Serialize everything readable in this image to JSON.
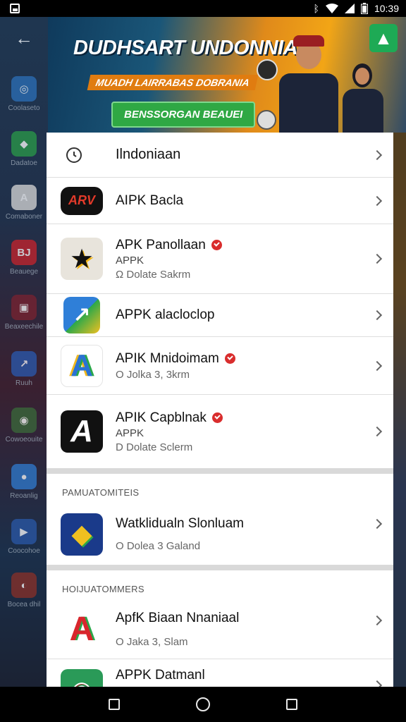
{
  "status": {
    "time": "10:39"
  },
  "side_apps": [
    {
      "label": "Coolaseto",
      "color": "#2c6fb8",
      "glyph": "◎"
    },
    {
      "label": "Dadatoe",
      "color": "#2a9a48",
      "glyph": "◆"
    },
    {
      "label": "Comaboner",
      "color": "#d8d8d8",
      "glyph": "A"
    },
    {
      "label": "Beauege",
      "color": "#c8232c",
      "glyph": "BJ"
    },
    {
      "label": "Beaxeechile",
      "color": "#7a2230",
      "glyph": "▣"
    },
    {
      "label": "Ruuh",
      "color": "#2a5ab0",
      "glyph": "↗"
    },
    {
      "label": "Cowoeouite",
      "color": "#3a6a3a",
      "glyph": "◉"
    },
    {
      "label": "Reoanlig",
      "color": "#2f7bd0",
      "glyph": "●"
    },
    {
      "label": "Coocohoe",
      "color": "#2a58a8",
      "glyph": "▶"
    },
    {
      "label": "Bocea dhil",
      "color": "#8a3028",
      "glyph": "◐"
    }
  ],
  "banner": {
    "title": "DUDHSART UNDONNIAN",
    "subtitle": "MUADH LAIRRABAS DOBRANIA",
    "cta": "BENSSORGAN BEAUEI"
  },
  "list": {
    "header_item": {
      "label": "Ilndoniaan"
    },
    "items": [
      {
        "title": "AIPK Bacla",
        "icon_text": "ARV",
        "verified": false,
        "sub": "",
        "meta": ""
      },
      {
        "title": "APK Panollaan",
        "icon_text": "★",
        "verified": true,
        "sub": "APPK",
        "meta": "Ω Dolate Sakrm"
      },
      {
        "title": "APPK alacloclop",
        "icon_text": "↗",
        "verified": false,
        "sub": "",
        "meta": ""
      },
      {
        "title": "APIK Mnidoimam",
        "icon_text": "A",
        "verified": true,
        "sub": "",
        "meta": "O Jolka 3, 3krm"
      },
      {
        "title": "APIK Capblnak",
        "icon_text": "A",
        "verified": true,
        "sub": "APPK",
        "meta": "D Dolate Sclerm"
      }
    ],
    "section1": {
      "heading": "PAMUATOMITEIS",
      "items": [
        {
          "title": "Watklidualn Slonluam",
          "icon_text": "◆",
          "meta": "O Dolea 3 Galand"
        }
      ]
    },
    "section2": {
      "heading": "HOIJUATOMMERS",
      "items": [
        {
          "title": "ApfK Biaan Nnaniaal",
          "icon_text": "A",
          "meta": "O Jaka 3, Slam"
        },
        {
          "title": "APPK Datmanl",
          "icon_text": "◉",
          "meta": ""
        }
      ]
    }
  }
}
